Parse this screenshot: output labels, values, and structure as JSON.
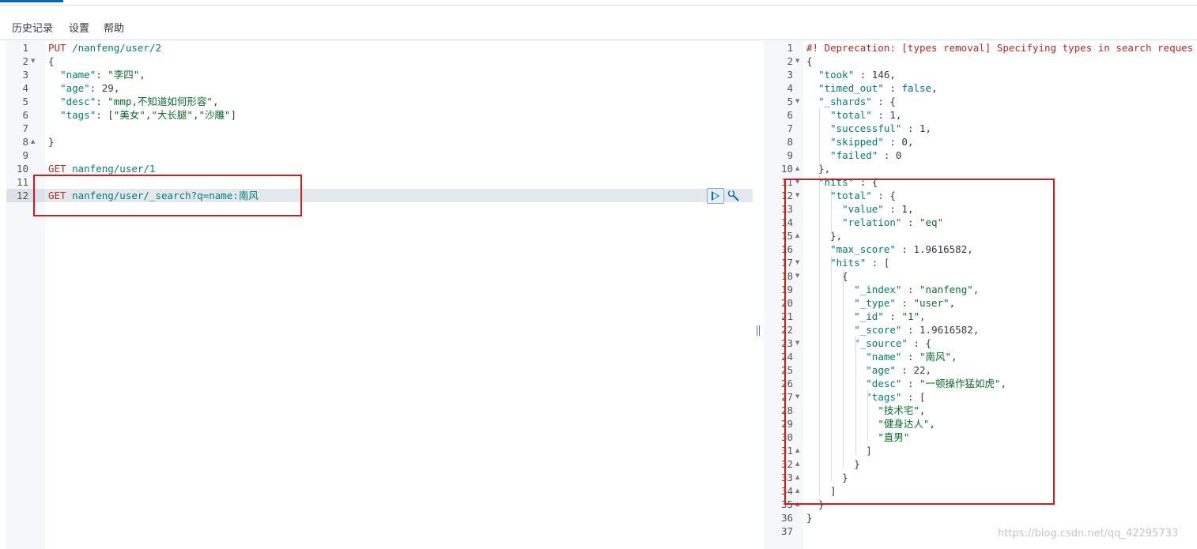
{
  "menu": {
    "history": "历史记录",
    "settings": "设置",
    "help": "帮助"
  },
  "request_lines": [
    {
      "n": "1",
      "fold": "",
      "segs": [
        [
          "k-method",
          "PUT"
        ],
        [
          "k-url",
          " /nanfeng/user/2"
        ]
      ]
    },
    {
      "n": "2",
      "fold": "▼",
      "segs": [
        [
          "k-punc",
          "{"
        ]
      ]
    },
    {
      "n": "3",
      "fold": "",
      "segs": [
        [
          "k-punc",
          "  "
        ],
        [
          "k-key",
          "\"name\""
        ],
        [
          "k-punc",
          ": "
        ],
        [
          "k-str",
          "\"李四\""
        ],
        [
          "k-punc",
          ","
        ]
      ]
    },
    {
      "n": "4",
      "fold": "",
      "segs": [
        [
          "k-punc",
          "  "
        ],
        [
          "k-key",
          "\"age\""
        ],
        [
          "k-punc",
          ": "
        ],
        [
          "k-num",
          "29"
        ],
        [
          "k-punc",
          ","
        ]
      ]
    },
    {
      "n": "5",
      "fold": "",
      "segs": [
        [
          "k-punc",
          "  "
        ],
        [
          "k-key",
          "\"desc\""
        ],
        [
          "k-punc",
          ": "
        ],
        [
          "k-str",
          "\"mmp,不知道如何形容\""
        ],
        [
          "k-punc",
          ","
        ]
      ]
    },
    {
      "n": "6",
      "fold": "",
      "segs": [
        [
          "k-punc",
          "  "
        ],
        [
          "k-key",
          "\"tags\""
        ],
        [
          "k-punc",
          ": ["
        ],
        [
          "k-str",
          "\"美女\""
        ],
        [
          "k-punc",
          ","
        ],
        [
          "k-str",
          "\"大长腿\""
        ],
        [
          "k-punc",
          ","
        ],
        [
          "k-str",
          "\"沙雕\""
        ],
        [
          "k-punc",
          "]"
        ]
      ]
    },
    {
      "n": "7",
      "fold": "",
      "segs": []
    },
    {
      "n": "8",
      "fold": "▲",
      "segs": [
        [
          "k-punc",
          "}"
        ]
      ]
    },
    {
      "n": "9",
      "fold": "",
      "segs": []
    },
    {
      "n": "10",
      "fold": "",
      "segs": [
        [
          "k-method",
          "GET"
        ],
        [
          "k-url",
          " nanfeng/user/1"
        ]
      ]
    },
    {
      "n": "11",
      "fold": "",
      "segs": []
    },
    {
      "n": "12",
      "fold": "",
      "segs": [
        [
          "k-method",
          "GET"
        ],
        [
          "k-url",
          " nanfeng/user/_search?q=name:南风"
        ]
      ]
    }
  ],
  "response_lines": [
    {
      "n": "1",
      "fold": "",
      "segs": [
        [
          "k-comment",
          "#! Deprecation: [types removal] Specifying types in search reques"
        ]
      ]
    },
    {
      "n": "2",
      "fold": "▼",
      "segs": [
        [
          "k-punc",
          "{"
        ]
      ]
    },
    {
      "n": "3",
      "fold": "",
      "segs": [
        [
          "k-punc",
          "  "
        ],
        [
          "k-key",
          "\"took\""
        ],
        [
          "k-punc",
          " : "
        ],
        [
          "k-num",
          "146"
        ],
        [
          "k-punc",
          ","
        ]
      ]
    },
    {
      "n": "4",
      "fold": "",
      "segs": [
        [
          "k-punc",
          "  "
        ],
        [
          "k-key",
          "\"timed_out\""
        ],
        [
          "k-punc",
          " : "
        ],
        [
          "k-bool",
          "false"
        ],
        [
          "k-punc",
          ","
        ]
      ]
    },
    {
      "n": "5",
      "fold": "▼",
      "segs": [
        [
          "k-punc",
          "  "
        ],
        [
          "k-key",
          "\"_shards\""
        ],
        [
          "k-punc",
          " : {"
        ]
      ]
    },
    {
      "n": "6",
      "fold": "",
      "segs": [
        [
          "k-punc",
          "    "
        ],
        [
          "k-key",
          "\"total\""
        ],
        [
          "k-punc",
          " : "
        ],
        [
          "k-num",
          "1"
        ],
        [
          "k-punc",
          ","
        ]
      ]
    },
    {
      "n": "7",
      "fold": "",
      "segs": [
        [
          "k-punc",
          "    "
        ],
        [
          "k-key",
          "\"successful\""
        ],
        [
          "k-punc",
          " : "
        ],
        [
          "k-num",
          "1"
        ],
        [
          "k-punc",
          ","
        ]
      ]
    },
    {
      "n": "8",
      "fold": "",
      "segs": [
        [
          "k-punc",
          "    "
        ],
        [
          "k-key",
          "\"skipped\""
        ],
        [
          "k-punc",
          " : "
        ],
        [
          "k-num",
          "0"
        ],
        [
          "k-punc",
          ","
        ]
      ]
    },
    {
      "n": "9",
      "fold": "",
      "segs": [
        [
          "k-punc",
          "    "
        ],
        [
          "k-key",
          "\"failed\""
        ],
        [
          "k-punc",
          " : "
        ],
        [
          "k-num",
          "0"
        ]
      ]
    },
    {
      "n": "10",
      "fold": "▲",
      "segs": [
        [
          "k-punc",
          "  },"
        ]
      ]
    },
    {
      "n": "11",
      "fold": "▼",
      "segs": [
        [
          "k-punc",
          "  "
        ],
        [
          "k-key",
          "\"hits\""
        ],
        [
          "k-punc",
          " : {"
        ]
      ]
    },
    {
      "n": "12",
      "fold": "▼",
      "segs": [
        [
          "k-punc",
          "    "
        ],
        [
          "k-key",
          "\"total\""
        ],
        [
          "k-punc",
          " : {"
        ]
      ]
    },
    {
      "n": "13",
      "fold": "",
      "segs": [
        [
          "k-punc",
          "      "
        ],
        [
          "k-key",
          "\"value\""
        ],
        [
          "k-punc",
          " : "
        ],
        [
          "k-num",
          "1"
        ],
        [
          "k-punc",
          ","
        ]
      ]
    },
    {
      "n": "14",
      "fold": "",
      "segs": [
        [
          "k-punc",
          "      "
        ],
        [
          "k-key",
          "\"relation\""
        ],
        [
          "k-punc",
          " : "
        ],
        [
          "k-str",
          "\"eq\""
        ]
      ]
    },
    {
      "n": "15",
      "fold": "▲",
      "segs": [
        [
          "k-punc",
          "    },"
        ]
      ]
    },
    {
      "n": "16",
      "fold": "",
      "segs": [
        [
          "k-punc",
          "    "
        ],
        [
          "k-key",
          "\"max_score\""
        ],
        [
          "k-punc",
          " : "
        ],
        [
          "k-num",
          "1.9616582"
        ],
        [
          "k-punc",
          ","
        ]
      ]
    },
    {
      "n": "17",
      "fold": "▼",
      "segs": [
        [
          "k-punc",
          "    "
        ],
        [
          "k-key",
          "\"hits\""
        ],
        [
          "k-punc",
          " : ["
        ]
      ]
    },
    {
      "n": "18",
      "fold": "▼",
      "segs": [
        [
          "k-punc",
          "      {"
        ]
      ]
    },
    {
      "n": "19",
      "fold": "",
      "segs": [
        [
          "k-punc",
          "        "
        ],
        [
          "k-key",
          "\"_index\""
        ],
        [
          "k-punc",
          " : "
        ],
        [
          "k-str",
          "\"nanfeng\""
        ],
        [
          "k-punc",
          ","
        ]
      ]
    },
    {
      "n": "20",
      "fold": "",
      "segs": [
        [
          "k-punc",
          "        "
        ],
        [
          "k-key",
          "\"_type\""
        ],
        [
          "k-punc",
          " : "
        ],
        [
          "k-str",
          "\"user\""
        ],
        [
          "k-punc",
          ","
        ]
      ]
    },
    {
      "n": "21",
      "fold": "",
      "segs": [
        [
          "k-punc",
          "        "
        ],
        [
          "k-key",
          "\"_id\""
        ],
        [
          "k-punc",
          " : "
        ],
        [
          "k-str",
          "\"1\""
        ],
        [
          "k-punc",
          ","
        ]
      ]
    },
    {
      "n": "22",
      "fold": "",
      "segs": [
        [
          "k-punc",
          "        "
        ],
        [
          "k-key",
          "\"_score\""
        ],
        [
          "k-punc",
          " : "
        ],
        [
          "k-num",
          "1.9616582"
        ],
        [
          "k-punc",
          ","
        ]
      ]
    },
    {
      "n": "23",
      "fold": "▼",
      "segs": [
        [
          "k-punc",
          "        "
        ],
        [
          "k-key",
          "\"_source\""
        ],
        [
          "k-punc",
          " : {"
        ]
      ]
    },
    {
      "n": "24",
      "fold": "",
      "segs": [
        [
          "k-punc",
          "          "
        ],
        [
          "k-key",
          "\"name\""
        ],
        [
          "k-punc",
          " : "
        ],
        [
          "k-str",
          "\"南风\""
        ],
        [
          "k-punc",
          ","
        ]
      ]
    },
    {
      "n": "25",
      "fold": "",
      "segs": [
        [
          "k-punc",
          "          "
        ],
        [
          "k-key",
          "\"age\""
        ],
        [
          "k-punc",
          " : "
        ],
        [
          "k-num",
          "22"
        ],
        [
          "k-punc",
          ","
        ]
      ]
    },
    {
      "n": "26",
      "fold": "",
      "segs": [
        [
          "k-punc",
          "          "
        ],
        [
          "k-key",
          "\"desc\""
        ],
        [
          "k-punc",
          " : "
        ],
        [
          "k-str",
          "\"一顿操作猛如虎\""
        ],
        [
          "k-punc",
          ","
        ]
      ]
    },
    {
      "n": "27",
      "fold": "▼",
      "segs": [
        [
          "k-punc",
          "          "
        ],
        [
          "k-key",
          "\"tags\""
        ],
        [
          "k-punc",
          " : ["
        ]
      ]
    },
    {
      "n": "28",
      "fold": "",
      "segs": [
        [
          "k-punc",
          "            "
        ],
        [
          "k-str",
          "\"技术宅\""
        ],
        [
          "k-punc",
          ","
        ]
      ]
    },
    {
      "n": "29",
      "fold": "",
      "segs": [
        [
          "k-punc",
          "            "
        ],
        [
          "k-str",
          "\"健身达人\""
        ],
        [
          "k-punc",
          ","
        ]
      ]
    },
    {
      "n": "30",
      "fold": "",
      "segs": [
        [
          "k-punc",
          "            "
        ],
        [
          "k-str",
          "\"直男\""
        ]
      ]
    },
    {
      "n": "31",
      "fold": "▲",
      "segs": [
        [
          "k-punc",
          "          ]"
        ]
      ]
    },
    {
      "n": "32",
      "fold": "▲",
      "segs": [
        [
          "k-punc",
          "        }"
        ]
      ]
    },
    {
      "n": "33",
      "fold": "▲",
      "segs": [
        [
          "k-punc",
          "      }"
        ]
      ]
    },
    {
      "n": "34",
      "fold": "▲",
      "segs": [
        [
          "k-punc",
          "    ]"
        ]
      ]
    },
    {
      "n": "35",
      "fold": "▲",
      "segs": [
        [
          "k-punc",
          "  }"
        ]
      ]
    },
    {
      "n": "36",
      "fold": "",
      "segs": [
        [
          "k-punc",
          "}"
        ]
      ]
    },
    {
      "n": "37",
      "fold": "",
      "segs": []
    }
  ],
  "watermark": "https://blog.csdn.net/qq_42295733"
}
